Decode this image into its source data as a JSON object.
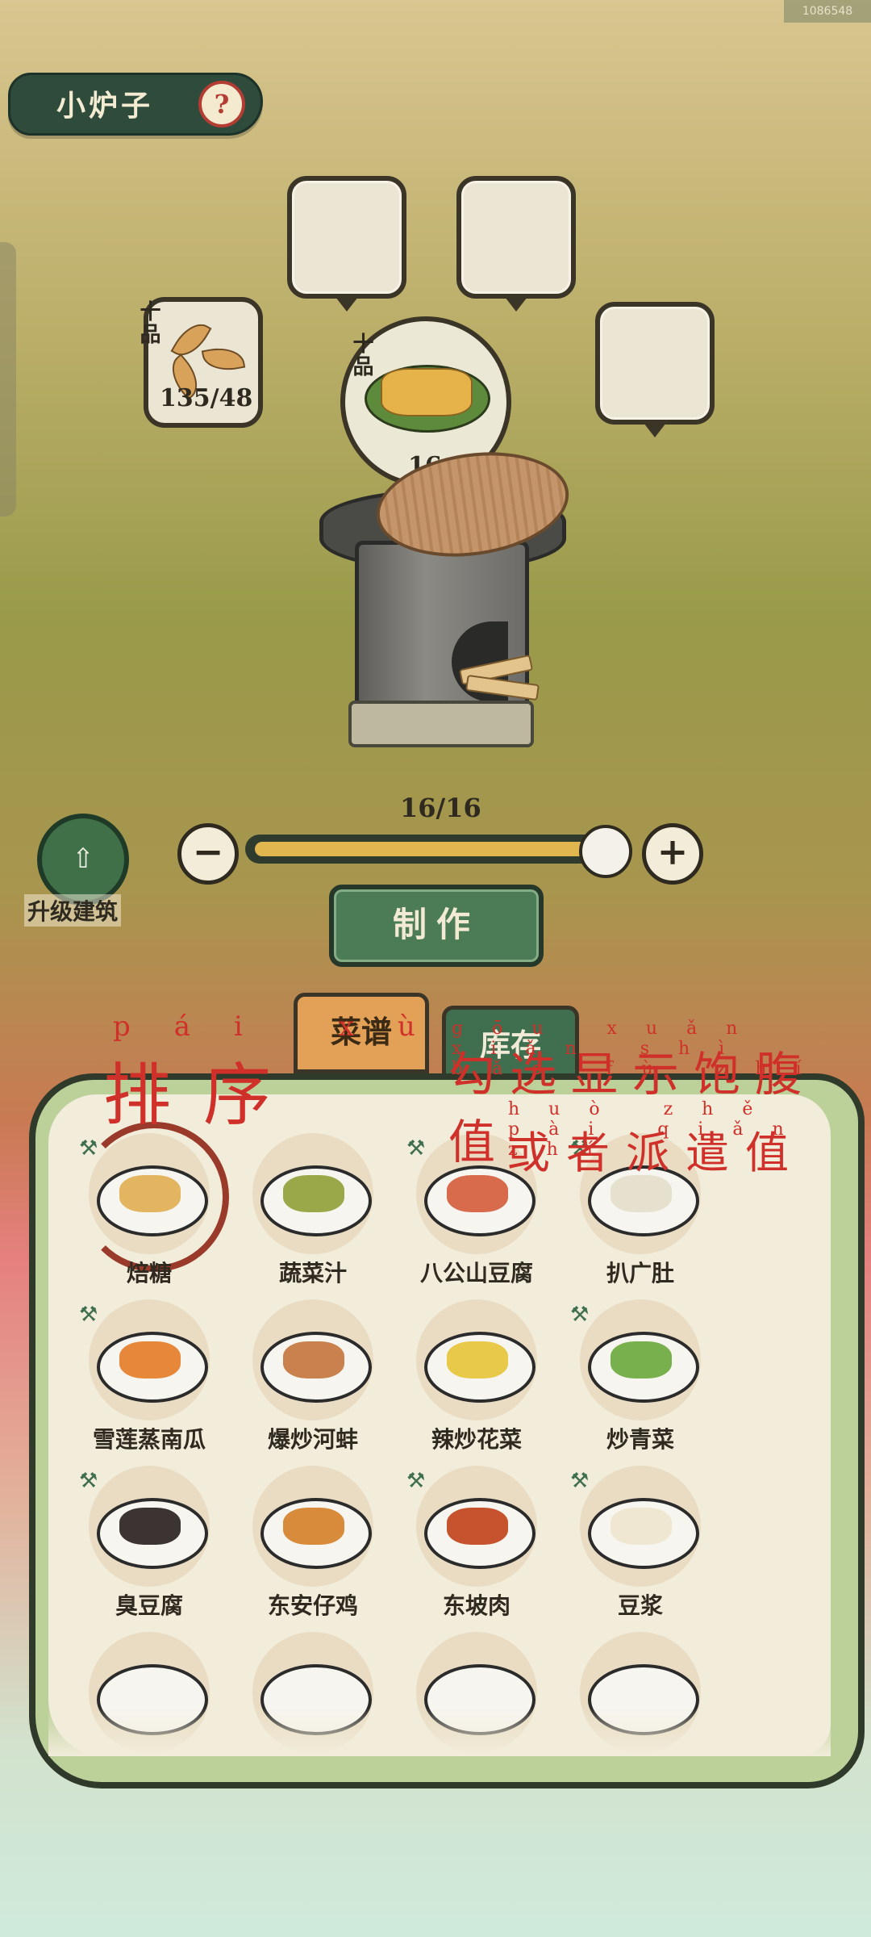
{
  "build_id": "1086548",
  "header": {
    "title": "小炉子",
    "help_icon": "question-icon"
  },
  "fuel": {
    "grade": "十品",
    "count": "135/48",
    "icon": "leaf-icon"
  },
  "food": {
    "grade": "十品",
    "count": "16"
  },
  "quantity": {
    "label": "16/16",
    "minus_icon": "minus-icon",
    "plus_icon": "plus-icon",
    "fill_fraction": 1.0
  },
  "upgrade": {
    "label": "升级建筑",
    "icon": "upgrade-arrow-icon"
  },
  "make_button": {
    "label": "制作"
  },
  "tabs": [
    {
      "label": "菜谱"
    },
    {
      "label": "库存"
    }
  ],
  "annotations": {
    "sort_pinyin": "pái xù",
    "sort": "排序",
    "line1_pinyin": "gōu xuǎn xiǎn shì bǎo fù zhí",
    "line1": "勾选显示饱腹值",
    "line2_pinyin": "huò zhě pài qiǎn zhí",
    "line2": "或者派遣值"
  },
  "recipes": [
    {
      "name": "焙糖",
      "color": "#e3b560"
    },
    {
      "name": "蔬菜汁",
      "color": "#9aa84a"
    },
    {
      "name": "八公山豆腐",
      "color": "#d86b4c"
    },
    {
      "name": "扒广肚",
      "color": "#e6e1cf"
    },
    {
      "name": "雪莲蒸南瓜",
      "color": "#e7873a"
    },
    {
      "name": "爆炒河蚌",
      "color": "#c9824e"
    },
    {
      "name": "辣炒花菜",
      "color": "#e8c94a"
    },
    {
      "name": "炒青菜",
      "color": "#79b04e"
    },
    {
      "name": "臭豆腐",
      "color": "#3c3433"
    },
    {
      "name": "东安仔鸡",
      "color": "#d88b3a"
    },
    {
      "name": "东坡肉",
      "color": "#c6522e"
    },
    {
      "name": "豆浆",
      "color": "#efe7d2"
    }
  ],
  "colors": {
    "accent": "#4c7c56",
    "annotation": "#d0302a",
    "slider": "#e2b64f"
  }
}
